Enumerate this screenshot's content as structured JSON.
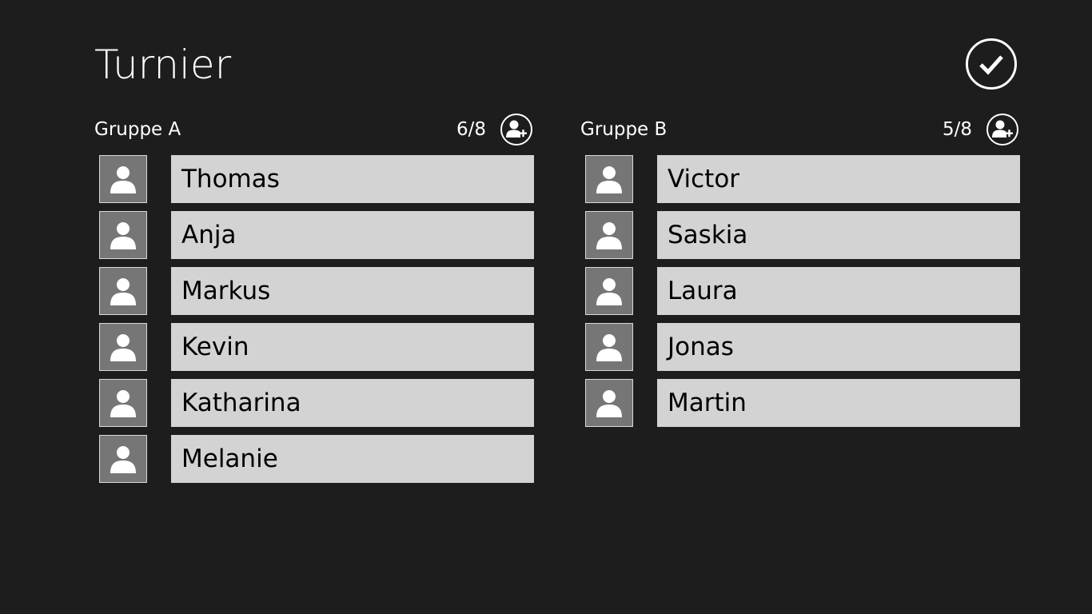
{
  "app": {
    "title": "Turnier"
  },
  "groups": [
    {
      "title": "Gruppe A",
      "count": "6/8",
      "add_icon": "add-user-icon",
      "players": [
        {
          "name": "Thomas",
          "icon": "person-icon"
        },
        {
          "name": "Anja",
          "icon": "person-icon"
        },
        {
          "name": "Markus",
          "icon": "person-icon"
        },
        {
          "name": "Kevin",
          "icon": "person-icon"
        },
        {
          "name": "Katharina",
          "icon": "person-icon"
        },
        {
          "name": "Melanie",
          "icon": "person-icon"
        }
      ]
    },
    {
      "title": "Gruppe B",
      "count": "5/8",
      "add_icon": "add-user-icon",
      "players": [
        {
          "name": "Victor",
          "icon": "person-icon"
        },
        {
          "name": "Saskia",
          "icon": "person-icon"
        },
        {
          "name": "Laura",
          "icon": "person-icon"
        },
        {
          "name": "Jonas",
          "icon": "person-icon"
        },
        {
          "name": "Martin",
          "icon": "person-icon"
        }
      ]
    }
  ],
  "actions": {
    "confirm_icon": "checkmark-icon"
  },
  "colors": {
    "background": "#1d1d1d",
    "name_field": "#d3d3d3",
    "avatar": "#767676",
    "text": "#ffffff"
  }
}
